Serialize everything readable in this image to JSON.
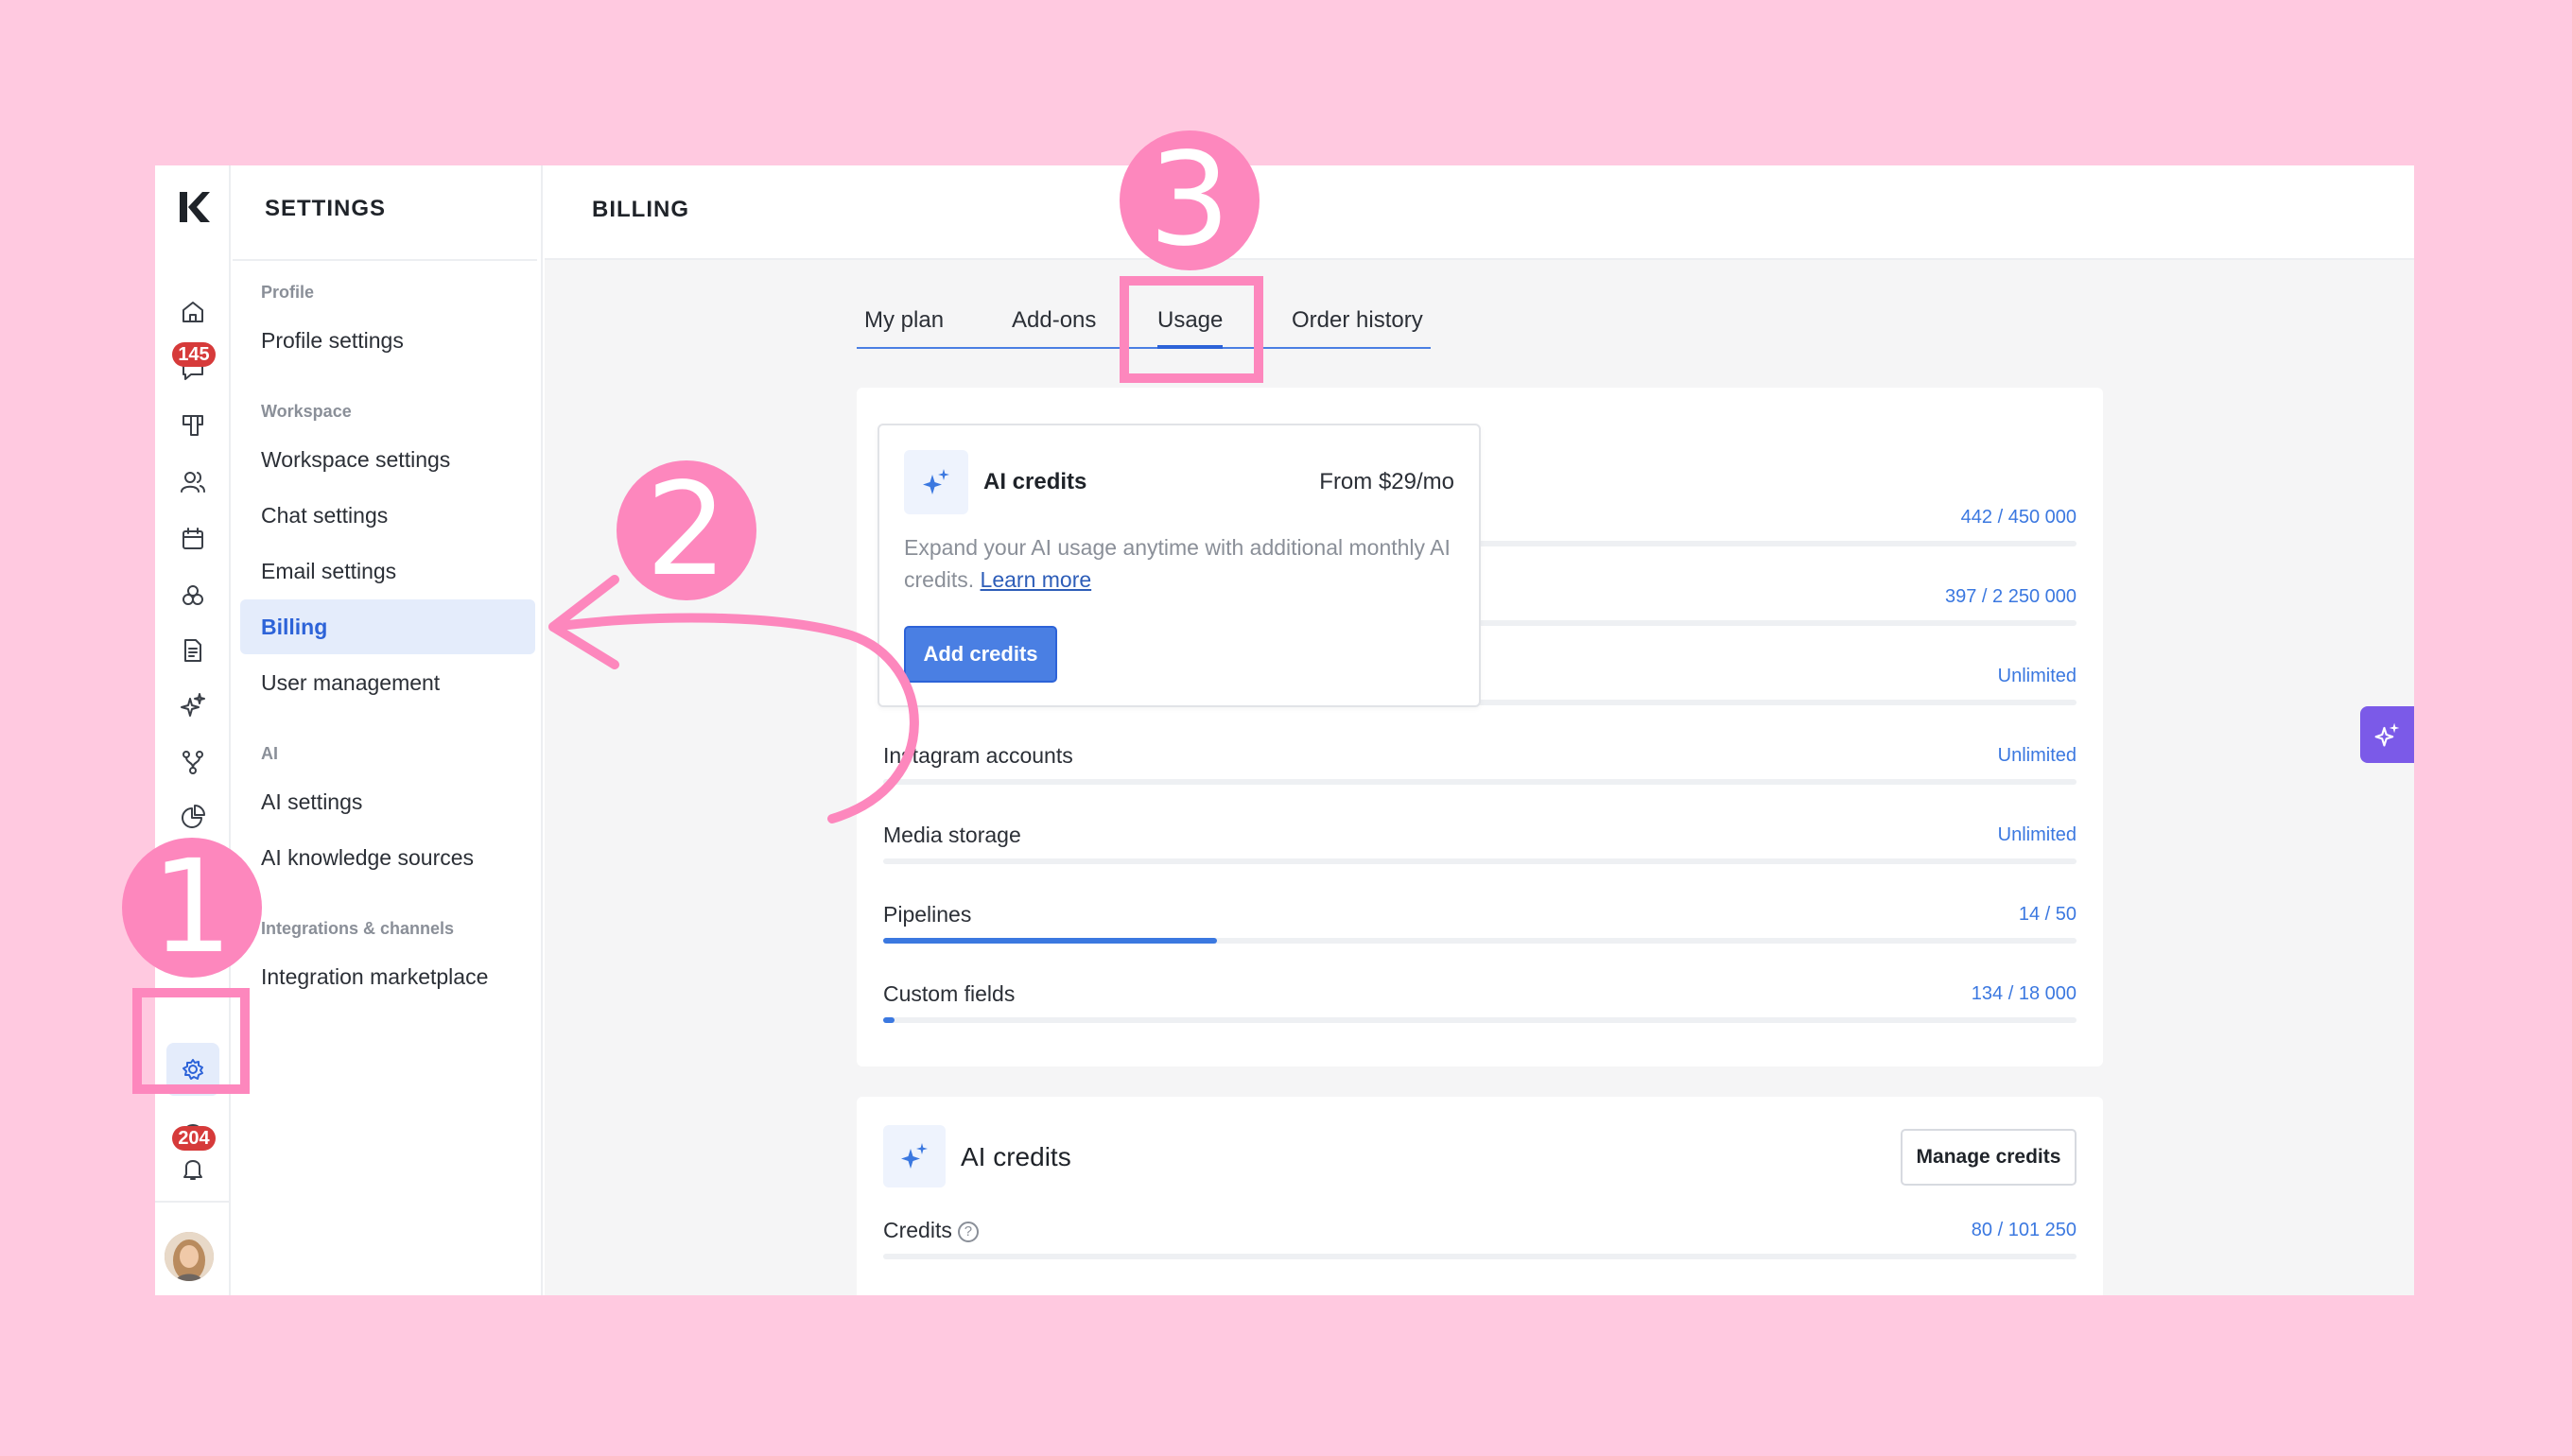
{
  "sidebar_rail": {
    "badges": {
      "chats": "145",
      "notifications": "204"
    },
    "items": [
      "home-icon",
      "chat-icon",
      "board-icon",
      "contacts-icon",
      "calendar-icon",
      "companies-icon",
      "document-icon",
      "ai-sparkle-icon",
      "workflow-icon",
      "reports-icon",
      "instagram-icon",
      "settings-icon",
      "help-icon",
      "bell-icon"
    ]
  },
  "settings_menu": {
    "title": "SETTINGS",
    "groups": [
      {
        "label": "Profile",
        "items": [
          "Profile settings"
        ]
      },
      {
        "label": "Workspace",
        "items": [
          "Workspace settings",
          "Chat settings",
          "Email settings",
          "Billing",
          "User management"
        ]
      },
      {
        "label": "AI",
        "items": [
          "AI settings",
          "AI knowledge sources"
        ]
      },
      {
        "label": "Integrations & channels",
        "items": [
          "Integration marketplace"
        ]
      }
    ],
    "active_item": "Billing"
  },
  "main": {
    "title": "BILLING",
    "tabs": [
      "My plan",
      "Add-ons",
      "Usage",
      "Order history"
    ],
    "active_tab": "Usage",
    "usage_rows": [
      {
        "label": "",
        "value": "442 / 450 000",
        "progress": 0.001
      },
      {
        "label": "",
        "value": "397 / 2 250 000",
        "progress": 0.0002
      },
      {
        "label": "",
        "value": "Unlimited",
        "progress": 0
      },
      {
        "label": "Instagram accounts",
        "value": "Unlimited",
        "progress": 0
      },
      {
        "label": "Media storage",
        "value": "Unlimited",
        "progress": 0
      },
      {
        "label": "Pipelines",
        "value": "14 / 50",
        "progress": 0.28
      },
      {
        "label": "Custom fields",
        "value": "134 / 18 000",
        "progress": 0.0074
      }
    ],
    "popover": {
      "title": "AI credits",
      "price": "From $29/mo",
      "description": "Expand your AI usage anytime with additional monthly AI credits.",
      "link": "Learn more",
      "button": "Add credits"
    },
    "credits_card": {
      "title": "AI credits",
      "button": "Manage credits",
      "label": "Credits",
      "help": "?",
      "value": "80 / 101 250"
    }
  },
  "annotations": {
    "step1": "1",
    "step2": "2",
    "step3": "3"
  },
  "colors": {
    "accent": "#2d63d8",
    "annotation": "#fd87bd",
    "page_bg": "#ffc9e0"
  }
}
